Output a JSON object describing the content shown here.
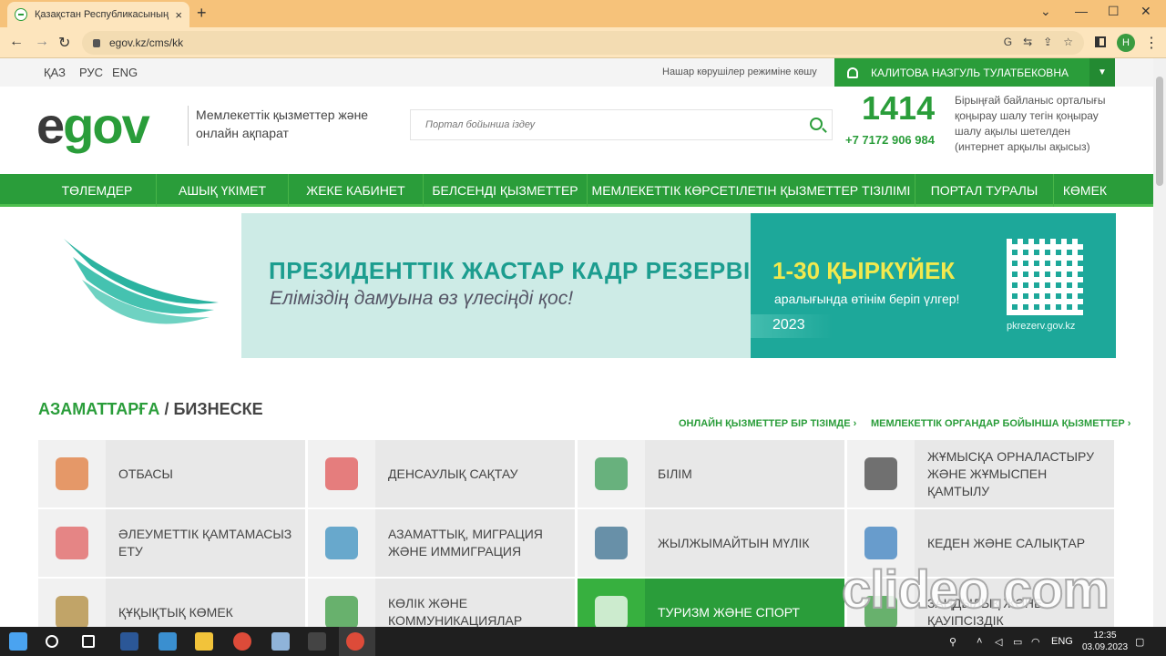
{
  "browser": {
    "tab_title": "Қазақстан Республикасының Э",
    "tab_close": "×",
    "new_tab": "+",
    "url": "egov.kz/cms/kk",
    "profile_initial": "H",
    "win_minimize": "⌄",
    "win_min": "—",
    "win_max": "☐",
    "win_close": "✕",
    "back": "←",
    "forward": "→",
    "reload": "↻",
    "omni_icons": [
      "G",
      "⇆",
      "⇪",
      "☆"
    ],
    "menu": "⋮"
  },
  "topstrip": {
    "languages": [
      "ҚАЗ",
      "РУС",
      "ENG"
    ],
    "low_vision": "Нашар көрушілер режиміне көшу",
    "user_name": "КАЛИТОВА НАЗГУЛЬ ТУЛАТБЕКОВНА",
    "dropdown": "▼"
  },
  "header": {
    "logo_e": "e",
    "logo_gov": "gov",
    "tagline": "Мемлекеттік қызметтер және онлайн ақпарат",
    "search_placeholder": "Портал бойынша іздеу",
    "phone_short": "1414",
    "phone_full": "+7 7172 906 984",
    "contact_text": "Бірыңғай байланыс орталығы қоңырау шалу тегін қоңырау шалу ақылы шетелден (интернет арқылы ақысыз)"
  },
  "mainnav": [
    "ТӨЛЕМДЕР",
    "АШЫҚ ҮКІМЕТ",
    "ЖЕКЕ КАБИНЕТ",
    "БЕЛСЕНДІ ҚЫЗМЕТТЕР",
    "МЕМЛЕКЕТТІК КӨРСЕТІЛЕТІН ҚЫЗМЕТТЕР ТІЗІЛІМІ",
    "ПОРТАЛ ТУРАЛЫ",
    "КӨМЕК"
  ],
  "banner": {
    "title": "ПРЕЗИДЕНТТІК ЖАСТАР КАДР РЕЗЕРВІ",
    "subtitle": "Еліміздің дамуына өз үлесіңді қос!",
    "dates": "1-30 ҚЫРКҮЙЕК",
    "dates_sub": "аралығында өтінім беріп үлгер!",
    "year": "2023",
    "url": "pkrezerv.gov.kz"
  },
  "section": {
    "title_a": "АЗАМАТТАРҒА",
    "title_sep": " / ",
    "title_b": "БИЗНЕСКЕ",
    "link1": "ОНЛАЙН ҚЫЗМЕТТЕР БІР ТІЗІМДЕ ›",
    "link2": "МЕМЛЕКЕТТІК ОРГАНДАР БОЙЫНША ҚЫЗМЕТТЕР ›"
  },
  "categories": [
    {
      "label": "ОТБАСЫ",
      "icon": "family-icon",
      "color": "#e07a3a"
    },
    {
      "label": "ДЕНСАУЛЫҚ САҚТАУ",
      "icon": "health-icon",
      "color": "#e05555"
    },
    {
      "label": "БІЛІМ",
      "icon": "books-icon",
      "color": "#3a9b55"
    },
    {
      "label": "ЖҰМЫСҚА ОРНАЛАСТЫРУ ЖӘНЕ ЖҰМЫСПЕН ҚАМТЫЛУ",
      "icon": "employee-icon",
      "color": "#444444"
    },
    {
      "label": "ӘЛЕУМЕТТІК ҚАМТАМАСЫЗ ЕТУ",
      "icon": "social-care-icon",
      "color": "#e06060"
    },
    {
      "label": "АЗАМАТТЫҚ, МИГРАЦИЯ ЖӘНЕ ИММИГРАЦИЯ",
      "icon": "globe-people-icon",
      "color": "#3a8fbf"
    },
    {
      "label": "ЖЫЛЖЫМАЙТЫН МҮЛІК",
      "icon": "building-icon",
      "color": "#3a6f8f"
    },
    {
      "label": "КЕДЕН ЖӘНЕ САЛЫҚТАР",
      "icon": "tax-document-icon",
      "color": "#3a7fbf"
    },
    {
      "label": "ҚҰҚЫҚТЫҚ КӨМЕК",
      "icon": "scales-icon",
      "color": "#b08a3a"
    },
    {
      "label": "КӨЛІК ЖӘНЕ КОММУНИКАЦИЯЛАР",
      "icon": "truck-icon",
      "color": "#3a9b40"
    },
    {
      "label": "ТУРИЗМ ЖӘНЕ СПОРТ",
      "icon": "sport-icon",
      "color": "#ffffff"
    },
    {
      "label": "ЗАҢДЫЛЫҚ ЖӘНЕ ҚАУІПСІЗДІК",
      "icon": "security-icon",
      "color": "#3a9b40"
    }
  ],
  "watermark": "clideo.com",
  "taskbar": {
    "lang": "ENG",
    "time": "12:35",
    "date": "03.09.2023",
    "apps": [
      {
        "name": "windows-start-icon",
        "color": "#4aa3f0"
      },
      {
        "name": "search-icon",
        "color": "#1f1f1f"
      },
      {
        "name": "task-view-icon",
        "color": "#1f1f1f"
      },
      {
        "name": "word-icon",
        "color": "#2b5797"
      },
      {
        "name": "desktop-icon",
        "color": "#3a8fd0"
      },
      {
        "name": "file-explorer-icon",
        "color": "#f2c33a"
      },
      {
        "name": "chrome-icon",
        "color": "#dd4b39"
      },
      {
        "name": "notepad-icon",
        "color": "#8fb3d9"
      },
      {
        "name": "obs-icon",
        "color": "#444444"
      },
      {
        "name": "chrome-profile-icon",
        "color": "#dd4b39"
      }
    ]
  }
}
